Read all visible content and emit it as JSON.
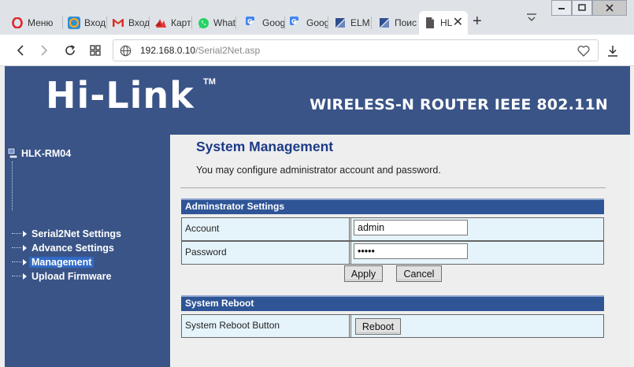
{
  "browser": {
    "tabs": [
      {
        "label": "Меню",
        "icon": "opera-icon",
        "active": false
      },
      {
        "label": "Вход",
        "icon": "mail-ru-icon",
        "active": false
      },
      {
        "label": "Вход",
        "icon": "gmail-icon",
        "active": false
      },
      {
        "label": "Карт",
        "icon": "maps-icon",
        "active": false
      },
      {
        "label": "What",
        "icon": "whatsapp-icon",
        "active": false
      },
      {
        "label": "Goog",
        "icon": "google-translate-icon",
        "active": false
      },
      {
        "label": "Goog",
        "icon": "google-translate-icon",
        "active": false
      },
      {
        "label": "ELM",
        "icon": "elm-icon",
        "active": false
      },
      {
        "label": "Поис",
        "icon": "elm-icon",
        "active": false
      },
      {
        "label": "HL",
        "icon": "document-icon",
        "active": true
      }
    ],
    "address": {
      "host": "192.168.0.10",
      "path": "/Serial2Net.asp"
    }
  },
  "banner": {
    "logo": "Hi-Link",
    "trademark": "TM",
    "tagline": "WIRELESS-N ROUTER IEEE 802.11N"
  },
  "sidebar": {
    "root": "HLK-RM04",
    "items": [
      {
        "label": "Serial2Net Settings",
        "selected": false
      },
      {
        "label": "Advance Settings",
        "selected": false
      },
      {
        "label": "Management",
        "selected": true
      },
      {
        "label": "Upload Firmware",
        "selected": false
      }
    ]
  },
  "main": {
    "title": "System Management",
    "intro": "You may configure administrator account and password.",
    "admin": {
      "heading": "Adminstrator Settings",
      "account_label": "Account",
      "account_value": "admin",
      "password_label": "Password",
      "password_value": "•••••",
      "apply_label": "Apply",
      "cancel_label": "Cancel"
    },
    "reboot": {
      "heading": "System Reboot",
      "button_row_label": "System Reboot Button",
      "reboot_label": "Reboot"
    }
  },
  "colors": {
    "banner": "#3a5487",
    "section_header": "#2f5597",
    "title": "#1d3b87",
    "label_cell": "#e5f4fb",
    "selected_item": "#316ac5"
  }
}
